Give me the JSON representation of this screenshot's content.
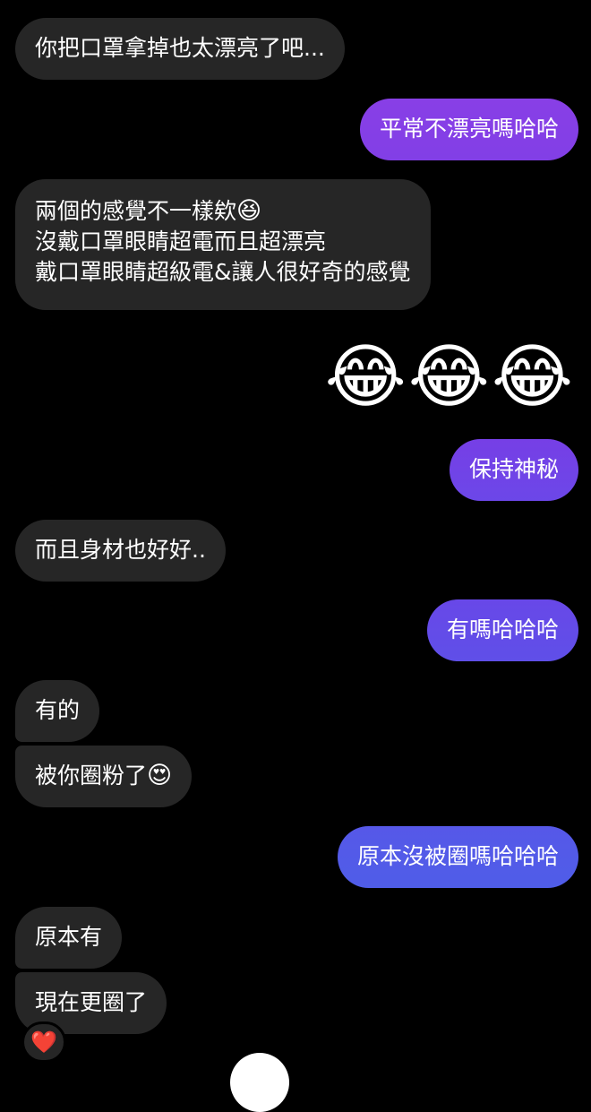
{
  "colors": {
    "background": "#000000",
    "incoming_bubble": "#262626",
    "outgoing_gradient_top": "#8a3fe6",
    "outgoing_gradient_bottom": "#4f5de8"
  },
  "messages": [
    {
      "id": "m1",
      "direction": "incoming",
      "text": "你把口罩拿掉也太漂亮了吧..."
    },
    {
      "id": "m2",
      "direction": "outgoing",
      "text": "平常不漂亮嗎哈哈"
    },
    {
      "id": "m3",
      "direction": "incoming",
      "lines": [
        "兩個的感覺不一樣欸",
        "沒戴口罩眼睛超電而且超漂亮",
        "戴口罩眼睛超級電&讓人很好奇的感覺"
      ],
      "emoji": "😆"
    },
    {
      "id": "m4",
      "direction": "outgoing",
      "emoji_only": "😂😂😂"
    },
    {
      "id": "m5",
      "direction": "outgoing",
      "text": "保持神秘"
    },
    {
      "id": "m6",
      "direction": "incoming",
      "text": "而且身材也好好.."
    },
    {
      "id": "m7",
      "direction": "outgoing",
      "text": "有嗎哈哈哈"
    },
    {
      "id": "m8",
      "direction": "incoming",
      "text": "有的"
    },
    {
      "id": "m9",
      "direction": "incoming",
      "text": "被你圈粉了",
      "emoji": "😍"
    },
    {
      "id": "m10",
      "direction": "outgoing",
      "text": "原本沒被圈嗎哈哈哈"
    },
    {
      "id": "m11",
      "direction": "incoming",
      "text": "原本有"
    },
    {
      "id": "m12",
      "direction": "incoming",
      "text": "現在更圈了",
      "reaction": "❤️"
    }
  ]
}
